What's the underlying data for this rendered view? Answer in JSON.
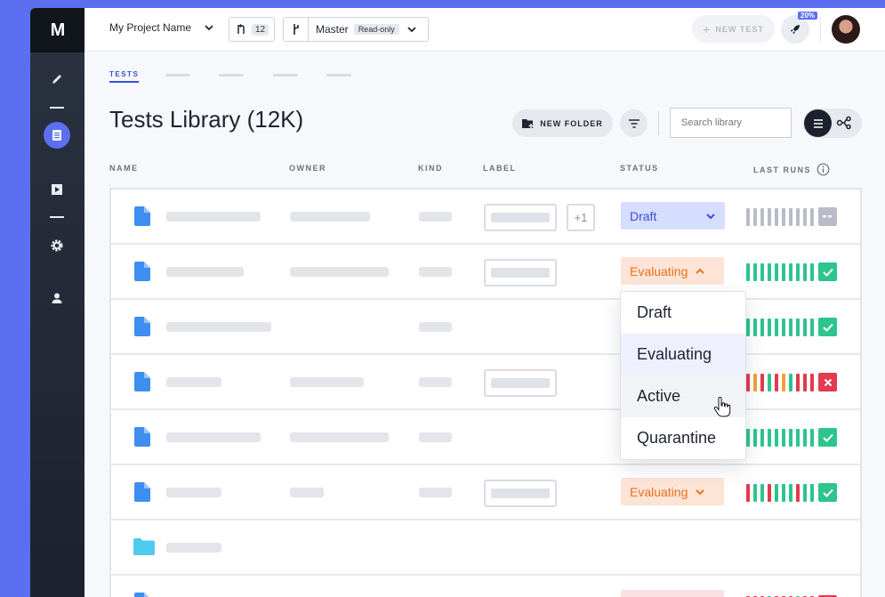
{
  "app": {
    "logo": "M"
  },
  "topbar": {
    "project_name": "My Project Name",
    "pull_requests": "12",
    "branch": "Master",
    "branch_badge": "Read-only",
    "new_test": "NEW TEST",
    "notif_badge": "20%"
  },
  "tabs": {
    "active": "TESTS"
  },
  "page": {
    "title": "Tests Library (12K)",
    "new_folder": "NEW FOLDER",
    "search_placeholder": "Search library"
  },
  "columns": {
    "name": "NAME",
    "owner": "OWNER",
    "kind": "KIND",
    "label": "LABEL",
    "status": "STATUS",
    "last_runs": "LAST RUNS"
  },
  "rows": {
    "r0": {
      "extra": "+1",
      "status": "Draft"
    },
    "r1": {
      "status": "Evaluating"
    },
    "r5": {
      "status": "Evaluating"
    }
  },
  "dropdown": {
    "options": [
      "Draft",
      "Evaluating",
      "Active",
      "Quarantine"
    ]
  },
  "colors": {
    "accent": "#5b6ff0",
    "draft": "#3b4fd8",
    "evaluating": "#e8711e",
    "pass": "#2ec48e",
    "fail": "#e23a4f",
    "warn": "#f0a03a",
    "pending": "#b8bcc6"
  }
}
